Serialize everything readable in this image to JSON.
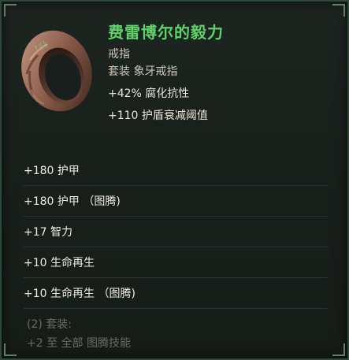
{
  "item": {
    "name": "费雷博尔的毅力",
    "type": "戒指",
    "set_type": "套装 象牙戒指",
    "implicits": [
      "+42% 腐化抗性",
      "+110 护盾衰减阈值"
    ],
    "name_color": "#5fd36a"
  },
  "icon": "ring-icon",
  "affixes": [
    "+180 护甲",
    "+180 护甲 （图腾)",
    "+17 智力",
    "+10 生命再生",
    "+10 生命再生 （图腾)"
  ],
  "set_bonus": {
    "header": "(2) 套装:",
    "bonus": "+2 至 全部 图腾技能"
  }
}
